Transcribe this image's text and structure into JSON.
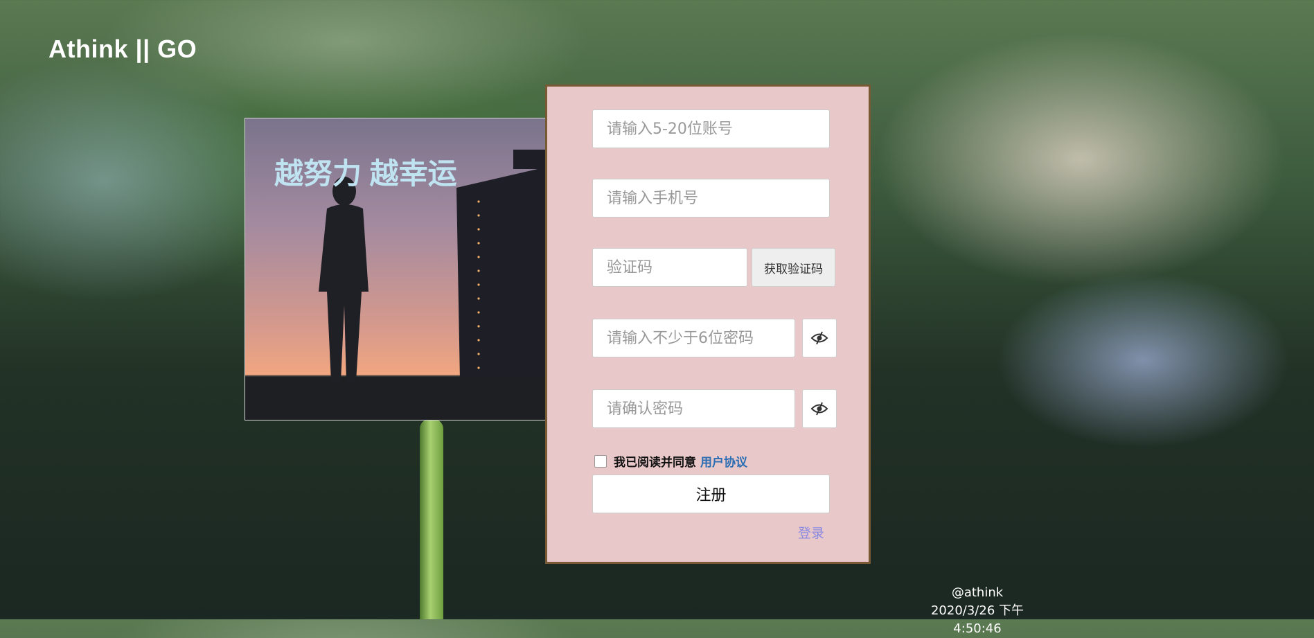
{
  "brand": {
    "title": "Athink || GO"
  },
  "photo": {
    "slogan": "越努力 越幸运"
  },
  "form": {
    "account_placeholder": "请输入5-20位账号",
    "phone_placeholder": "请输入手机号",
    "code_placeholder": "验证码",
    "get_code_label": "获取验证码",
    "password_placeholder": "请输入不少于6位密码",
    "confirm_placeholder": "请确认密码",
    "agree_text": "我已阅读并同意",
    "agree_link": "用户协议",
    "agree_checked": false,
    "submit_label": "注册",
    "login_link": "登录"
  },
  "footer": {
    "author": "@athink",
    "datetime": "2020/3/26 下午4:50:46"
  },
  "icons": {
    "password_toggle": "eye-slash-icon"
  },
  "colors": {
    "panel_bg": "#e8c8c8",
    "panel_border": "#7a5a35",
    "link": "#2a6db2",
    "login_link": "#8a8ae0",
    "slogan": "#bfe3f1"
  }
}
